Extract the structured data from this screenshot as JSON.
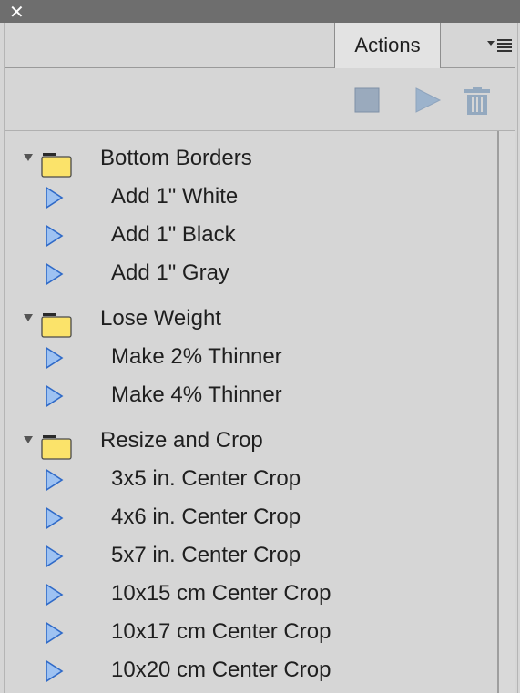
{
  "window": {
    "close_glyph": "✕"
  },
  "tabs": [
    {
      "label": "Actions",
      "active": true
    }
  ],
  "toolbar": {
    "buttons": [
      {
        "name": "stop-recording",
        "icon": "stop-square-icon",
        "enabled": false
      },
      {
        "name": "play-selection",
        "icon": "play-icon",
        "enabled": false
      },
      {
        "name": "delete",
        "icon": "trash-icon",
        "enabled": false
      }
    ]
  },
  "groups": [
    {
      "label": "Bottom Borders",
      "expanded": true,
      "items": [
        "Add 1\" White",
        "Add 1\" Black",
        "Add 1\" Gray"
      ]
    },
    {
      "label": "Lose Weight",
      "expanded": true,
      "items": [
        "Make 2% Thinner",
        "Make 4% Thinner"
      ]
    },
    {
      "label": "Resize and Crop",
      "expanded": true,
      "items": [
        "3x5 in. Center Crop",
        "4x6 in. Center Crop",
        "5x7 in. Center Crop",
        "10x15 cm Center Crop",
        "10x17 cm Center Crop",
        "10x20 cm Center Crop"
      ]
    }
  ],
  "colors": {
    "folder_fill": "#fbe36a",
    "folder_stroke": "#5a5a5a",
    "play_fill": "#9ec2f2",
    "play_stroke": "#2f6ac8",
    "disabled_icon": "#8fa6bf"
  }
}
